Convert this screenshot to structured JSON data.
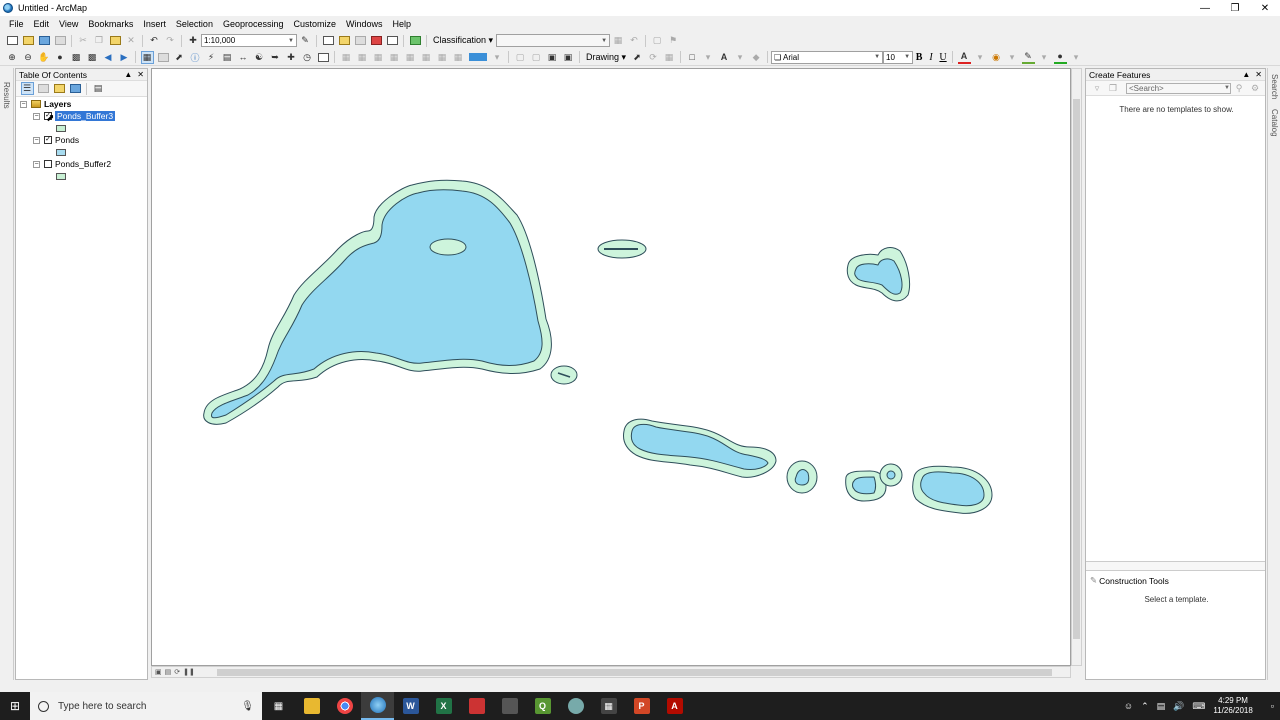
{
  "window": {
    "title": "Untitled - ArcMap"
  },
  "menu": [
    "File",
    "Edit",
    "View",
    "Bookmarks",
    "Insert",
    "Selection",
    "Geoprocessing",
    "Customize",
    "Windows",
    "Help"
  ],
  "toolbar": {
    "scale": "1:10,000",
    "classification_label": "Classification",
    "drawing_label": "Drawing",
    "font_name": "Arial",
    "font_size": "10",
    "bold": "B",
    "italic": "I",
    "underline": "U",
    "text_tool": "A"
  },
  "left_dock": {
    "results_tab": "Results"
  },
  "toc": {
    "title": "Table Of Contents",
    "root": "Layers",
    "layers": [
      {
        "name": "Ponds_Buffer3",
        "checked": true,
        "selected": true,
        "color": "#c8f0d4"
      },
      {
        "name": "Ponds",
        "checked": true,
        "selected": false,
        "color": "#a8dcf0"
      },
      {
        "name": "Ponds_Buffer2",
        "checked": false,
        "selected": false,
        "color": "#c8f0d4"
      }
    ]
  },
  "create_features": {
    "title": "Create Features",
    "search_placeholder": "<Search>",
    "empty_message": "There are no templates to show.",
    "construction_title": "Construction Tools",
    "construction_message": "Select a template."
  },
  "right_dock": {
    "search_tab": "Search",
    "catalog_tab": "Catalog"
  },
  "colors": {
    "pond_fill": "#93d8f0",
    "buffer_fill": "#cdf4dc",
    "outline": "#2e4e5a",
    "selection": "#3377d6"
  },
  "taskbar": {
    "search_placeholder": "Type here to search",
    "time": "4:29 PM",
    "date": "11/26/2018"
  }
}
